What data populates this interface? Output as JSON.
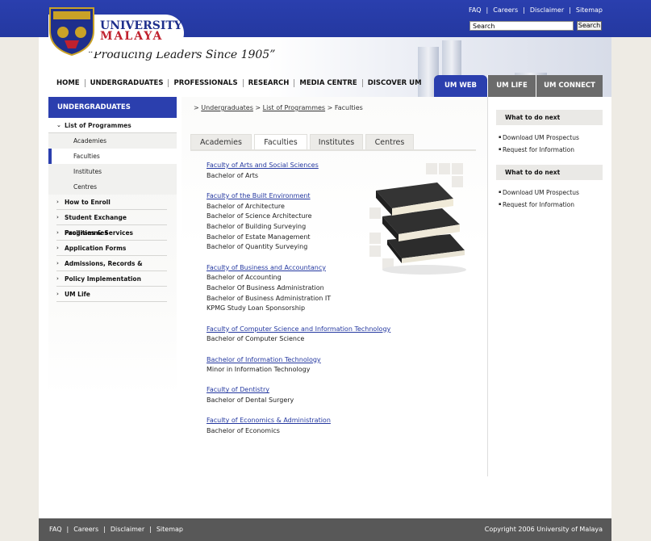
{
  "top": {
    "links": [
      "FAQ",
      "Careers",
      "Disclaimer",
      "Sitemap"
    ],
    "search_placeholder": "Search",
    "search_button": "Search"
  },
  "header": {
    "university_line1": "UNIVERSITY",
    "university_line2": "MALAYA",
    "tagline": "“Producing Leaders Since 1905”"
  },
  "mainnav": [
    "HOME",
    "UNDERGRADUATES",
    "PROFESSIONALS",
    "RESEARCH",
    "MEDIA CENTRE",
    "DISCOVER UM"
  ],
  "right_tabs": [
    "UM WEB",
    "UM LIFE",
    "UM CONNECT"
  ],
  "sidebar": {
    "title": "UNDERGRADUATES",
    "open_item": "List of Programmes",
    "sub_items": [
      "Academies",
      "Faculties",
      "Institutes",
      "Centres"
    ],
    "active_sub": "Faculties",
    "items": [
      "How to Enroll",
      "Student Exchange Programmes",
      "Facilities & Services",
      "Application Forms",
      "Admissions, Records &",
      "Policy Implementation",
      "UM Life"
    ]
  },
  "breadcrumb": {
    "prefix": ">",
    "link1": "Undergraduates",
    "sep": ">",
    "link2": "List of Programmes",
    "current": "Faculties"
  },
  "content_tabs": [
    "Academies",
    "Faculties",
    "Institutes",
    "Centres"
  ],
  "active_tab": "Faculties",
  "faculties": [
    {
      "name": "Faculty of Arts and Social Sciences",
      "programmes": [
        "Bachelor of Arts"
      ]
    },
    {
      "name": "Faculty of the Built Environment",
      "programmes": [
        "Bachelor of Architecture",
        "Bachelor of Science Architecture",
        "Bachelor of Building Surveying",
        "Bachelor of Estate Management",
        "Bachelor of Quantity Surveying"
      ]
    },
    {
      "name": "Faculty of Business and Accountancy",
      "programmes": [
        "Bachelor of Accounting",
        "Bachelor Of Business Administration",
        "Bachelor of Business Administration IT",
        "KPMG Study Loan Sponsorship"
      ]
    },
    {
      "name": "Faculty of Computer Science and Information Technology",
      "programmes": [
        "Bachelor of Computer Science"
      ]
    },
    {
      "name": "Bachelor of Information Technology",
      "programmes": [
        "Minor in Information Technology"
      ]
    },
    {
      "name": "Faculty of Dentistry",
      "programmes": [
        "Bachelor of Dental Surgery"
      ]
    },
    {
      "name": "Faculty of Economics & Administration",
      "programmes": [
        "Bachelor of Economics"
      ]
    }
  ],
  "right_boxes": [
    {
      "title": "What to do next",
      "items": [
        "Download UM Prospectus",
        "Request for Information"
      ]
    },
    {
      "title": "What to do next",
      "items": [
        "Download UM Prospectus",
        "Request for Information"
      ]
    }
  ],
  "footer": {
    "links": [
      "FAQ",
      "Careers",
      "Disclaimer",
      "Sitemap"
    ],
    "copyright": "Copyright  2006 University of Malaya"
  },
  "colors": {
    "brand_blue": "#2b3fae",
    "brand_red": "#c0212e",
    "footer_grey": "#585858",
    "link_blue": "#2438a0"
  }
}
